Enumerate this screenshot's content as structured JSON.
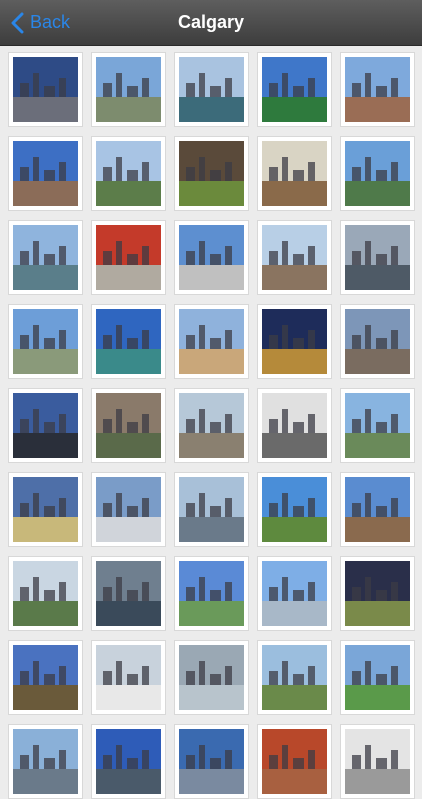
{
  "nav": {
    "back_label": "Back",
    "title": "Calgary"
  },
  "colors": {
    "accent": "#2a86e8",
    "navbar": "#4a4a4a"
  },
  "photos": [
    {
      "sky": "#2e4b86",
      "ground": "#6b6e7a"
    },
    {
      "sky": "#7aa6d8",
      "ground": "#7d8c6e"
    },
    {
      "sky": "#a9c3e0",
      "ground": "#3c6b7a"
    },
    {
      "sky": "#3f77c9",
      "ground": "#2e7a3d"
    },
    {
      "sky": "#7ea9dc",
      "ground": "#9a6d55"
    },
    {
      "sky": "#3d6fc4",
      "ground": "#8b6c58"
    },
    {
      "sky": "#a8c4e4",
      "ground": "#5c7d4a"
    },
    {
      "sky": "#5a4a3a",
      "ground": "#6b8a3c"
    },
    {
      "sky": "#d9d4c4",
      "ground": "#8a6a4a"
    },
    {
      "sky": "#6a9fd8",
      "ground": "#4f7a4a"
    },
    {
      "sky": "#8fb4dd",
      "ground": "#5a7e8a"
    },
    {
      "sky": "#c43a2a",
      "ground": "#b0aaa0"
    },
    {
      "sky": "#5d8fd0",
      "ground": "#c0c0c0"
    },
    {
      "sky": "#b8cfe6",
      "ground": "#8a7460"
    },
    {
      "sky": "#9aa8b8",
      "ground": "#4e5a66"
    },
    {
      "sky": "#6d9ed8",
      "ground": "#8a9a7a"
    },
    {
      "sky": "#2f66c0",
      "ground": "#3a8a8a"
    },
    {
      "sky": "#8fb2dc",
      "ground": "#c9a77a"
    },
    {
      "sky": "#1e2c5a",
      "ground": "#b58a3a"
    },
    {
      "sky": "#7d96b8",
      "ground": "#7a6c60"
    },
    {
      "sky": "#3a5c9e",
      "ground": "#2a2f3a"
    },
    {
      "sky": "#8a7a6a",
      "ground": "#5a6a4a"
    },
    {
      "sky": "#b6c8d8",
      "ground": "#8a8070"
    },
    {
      "sky": "#e0e0e0",
      "ground": "#6a6a6a"
    },
    {
      "sky": "#88b4e0",
      "ground": "#6a8a5a"
    },
    {
      "sky": "#4e6fa8",
      "ground": "#c8b87a"
    },
    {
      "sky": "#7a9cc8",
      "ground": "#d0d4da"
    },
    {
      "sky": "#a8c0d8",
      "ground": "#6a7a8a"
    },
    {
      "sky": "#4a8ed8",
      "ground": "#5e8a3e"
    },
    {
      "sky": "#5a8cd0",
      "ground": "#8a6a4e"
    },
    {
      "sky": "#c9d6e2",
      "ground": "#5a7a4a"
    },
    {
      "sky": "#6f7f8f",
      "ground": "#3a4a5a"
    },
    {
      "sky": "#5a8ad6",
      "ground": "#6a9a5a"
    },
    {
      "sky": "#7eaee6",
      "ground": "#a8b8c8"
    },
    {
      "sky": "#2a2f4a",
      "ground": "#7a8a4a"
    },
    {
      "sky": "#4a72c0",
      "ground": "#6a5a3a"
    },
    {
      "sky": "#c8d2dc",
      "ground": "#e8e8e8"
    },
    {
      "sky": "#9aa8b4",
      "ground": "#b8c4cc"
    },
    {
      "sky": "#9bbede",
      "ground": "#6a8a4a"
    },
    {
      "sky": "#7aa6d8",
      "ground": "#5a9a4a"
    },
    {
      "sky": "#8ab0d8",
      "ground": "#6a7a8a"
    },
    {
      "sky": "#2e5cb8",
      "ground": "#4a5a6a"
    },
    {
      "sky": "#3a6ab0",
      "ground": "#7a8aa0"
    },
    {
      "sky": "#b8482a",
      "ground": "#a86040"
    },
    {
      "sky": "#e4e4e4",
      "ground": "#9a9a9a"
    }
  ]
}
